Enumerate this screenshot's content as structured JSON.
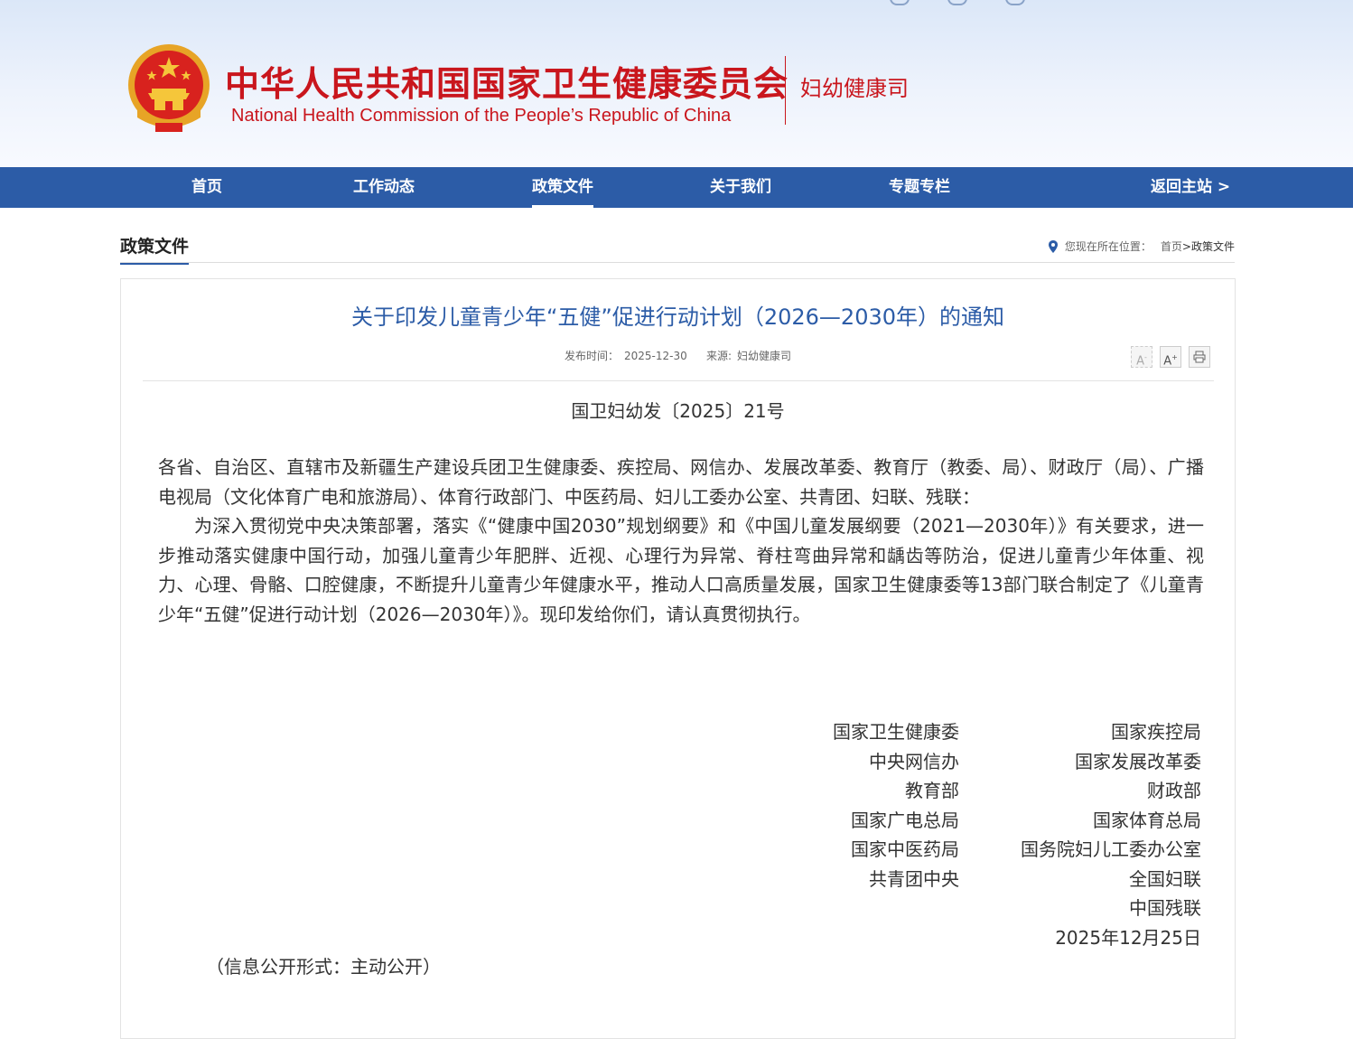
{
  "header": {
    "cn_title": "中华人民共和国国家卫生健康委员会",
    "en_title": "National Health Commission of the People’s  Republic of China",
    "dept": "妇幼健康司"
  },
  "nav": {
    "items": [
      {
        "label": "首页"
      },
      {
        "label": "工作动态"
      },
      {
        "label": "政策文件"
      },
      {
        "label": "关于我们"
      },
      {
        "label": "专题专栏"
      },
      {
        "label": "返回主站 >"
      }
    ],
    "active_index": 2
  },
  "section": {
    "title": "政策文件",
    "location_label": "您现在所在位置：",
    "crumb_home": "首页",
    "crumb_sep": ">",
    "crumb_current": "政策文件"
  },
  "article": {
    "title": "关于印发儿童青少年“五健”促进行动计划（2026—2030年）的通知",
    "date_label": "发布时间：",
    "date": "2025-12-30",
    "source_label": "来源:",
    "source": "妇幼健康司",
    "tools": {
      "font_smaller": "A",
      "font_larger": "A",
      "print": "print-icon"
    },
    "doc_no": "国卫妇幼发〔2025〕21号",
    "addressee": "各省、自治区、直辖市及新疆生产建设兵团卫生健康委、疾控局、网信办、发展改革委、教育厅（教委、局）、财政厅（局）、广播电视局（文化体育广电和旅游局）、体育行政部门、中医药局、妇儿工委办公室、共青团、妇联、残联：",
    "paragraph": "为深入贯彻党中央决策部署，落实《“健康中国2030”规划纲要》和《中国儿童发展纲要（2021—2030年）》有关要求，进一步推动落实健康中国行动，加强儿童青少年肥胖、近视、心理行为异常、脊柱弯曲异常和龋齿等防治，促进儿童青少年体重、视力、心理、骨骼、口腔健康，不断提升儿童青少年健康水平，推动人口高质量发展，国家卫生健康委等13部门联合制定了《儿童青少年“五健”促进行动计划（2026—2030年）》。现印发给你们，请认真贯彻执行。",
    "signers_left": [
      "国家卫生健康委",
      "中央网信办",
      "教育部",
      "国家广电总局",
      "国家中医药局",
      "共青团中央"
    ],
    "signers_right": [
      "国家疾控局",
      "国家发展改革委",
      "财政部",
      "国家体育总局",
      "国务院妇儿工委办公室",
      "全国妇联",
      "中国残联"
    ],
    "sign_date": "2025年12月25日",
    "disclosure": "（信息公开形式：主动公开）"
  },
  "colors": {
    "brand_red": "#c9161d",
    "nav_blue": "#2c5ca7",
    "title_blue": "#2c5ca7"
  }
}
